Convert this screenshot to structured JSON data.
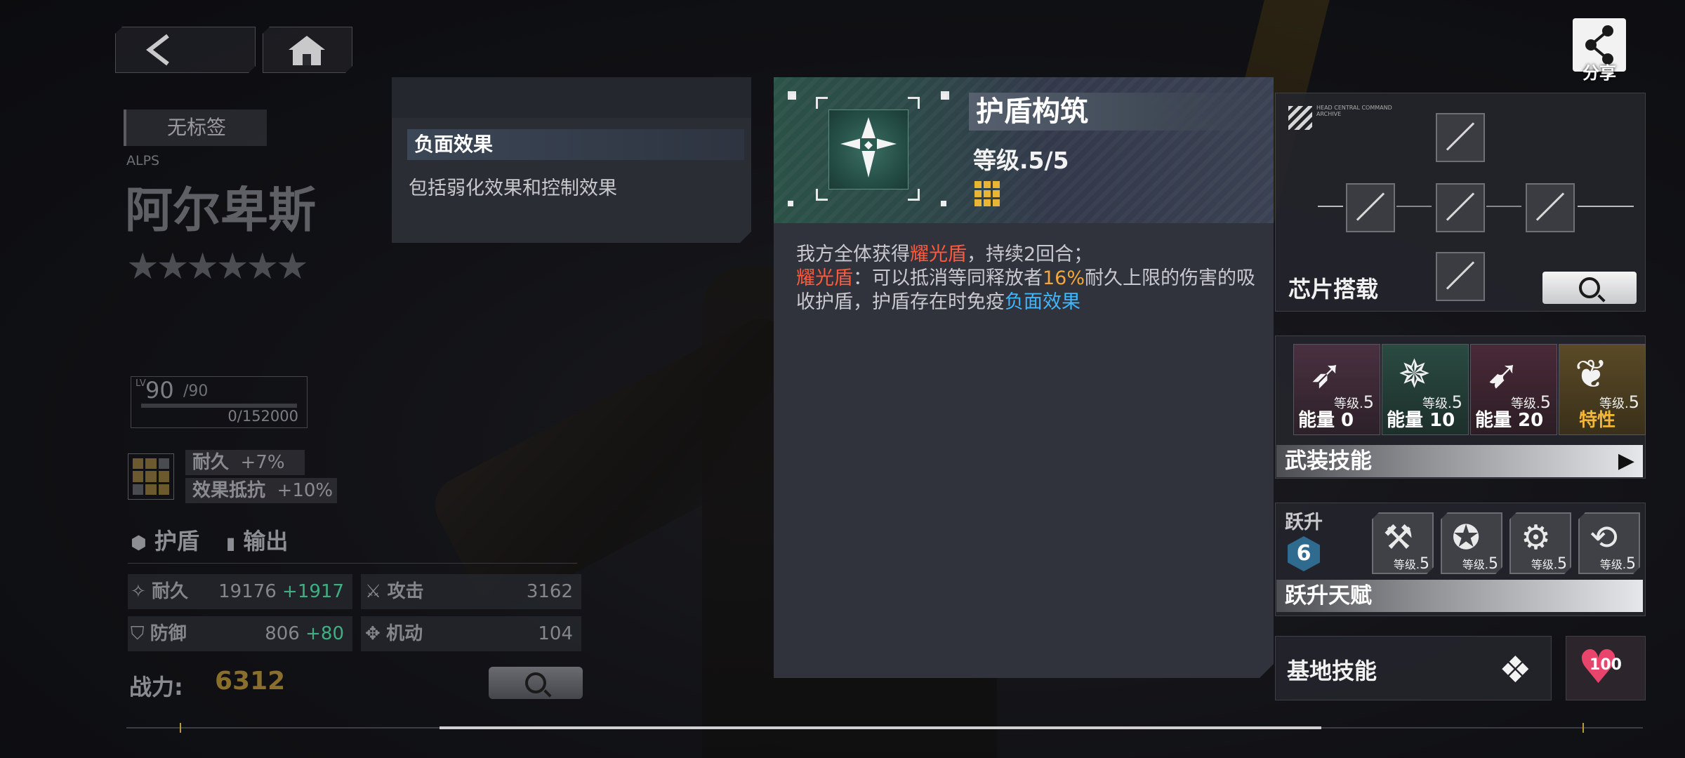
{
  "nav": {
    "back_icon": "back-arrow-icon",
    "home_icon": "home-icon"
  },
  "share": {
    "label": "分享",
    "icon": "share-icon"
  },
  "character": {
    "tag": "无标签",
    "code": "ALPS",
    "name": "阿尔卑斯",
    "stars": "★★★★★★",
    "level": "90",
    "level_max": "/90",
    "exp": "0/152000",
    "props": [
      {
        "label": "耐久",
        "value": "+7%"
      },
      {
        "label": "效果抵抗",
        "value": "+10%"
      }
    ],
    "roles": [
      {
        "label": "护盾",
        "icon": "shield-role-icon"
      },
      {
        "label": "输出",
        "icon": "dps-role-icon"
      }
    ],
    "stats": [
      {
        "label": "耐久",
        "value": "19176",
        "bonus": "+1917"
      },
      {
        "label": "攻击",
        "value": "3162",
        "bonus": ""
      },
      {
        "label": "防御",
        "value": "806",
        "bonus": "+80"
      },
      {
        "label": "机动",
        "value": "104",
        "bonus": ""
      }
    ],
    "power_label": "战力:",
    "power_value": "6312"
  },
  "tooltip": {
    "title": "负面效果",
    "desc": "包括弱化效果和控制效果"
  },
  "skill_card": {
    "name": "护盾构筑",
    "level": "等级.5/5",
    "desc": {
      "p1": "我方全体获得",
      "k1": "耀光盾",
      "p2": "，持续2回合；",
      "k2": "耀光盾",
      "p3": "：可以抵消等同释放者",
      "pct": "16%",
      "p4": "耐久上限的伤害的吸收护盾，护盾存在时免疫",
      "link": "负面效果"
    },
    "accent": "#ff5a3c"
  },
  "chips": {
    "header": "HEAD CENTRAL COMMAND ARCHIVE",
    "title": "芯片搭载"
  },
  "weapon_skills": {
    "title": "武装技能",
    "items": [
      {
        "lv_prefix": "等级.",
        "lv": "5",
        "energy": "能量  0",
        "tint": "#3a2a33"
      },
      {
        "lv_prefix": "等级.",
        "lv": "5",
        "energy": "能量 10",
        "tint": "#1f3a33"
      },
      {
        "lv_prefix": "等级.",
        "lv": "5",
        "energy": "能量 20",
        "tint": "#3a2430"
      },
      {
        "lv_prefix": "等级.",
        "lv": "5",
        "energy": "特性",
        "tint": "#4a3d1e"
      }
    ]
  },
  "transcend": {
    "label": "跃升",
    "rank": "6",
    "title": "跃升天赋",
    "items": [
      {
        "lv_prefix": "等级.",
        "lv": "5"
      },
      {
        "lv_prefix": "等级.",
        "lv": "5"
      },
      {
        "lv_prefix": "等级.",
        "lv": "5"
      },
      {
        "lv_prefix": "等级.",
        "lv": "5"
      }
    ]
  },
  "base_skill": {
    "title": "基地技能",
    "affection": "100"
  }
}
